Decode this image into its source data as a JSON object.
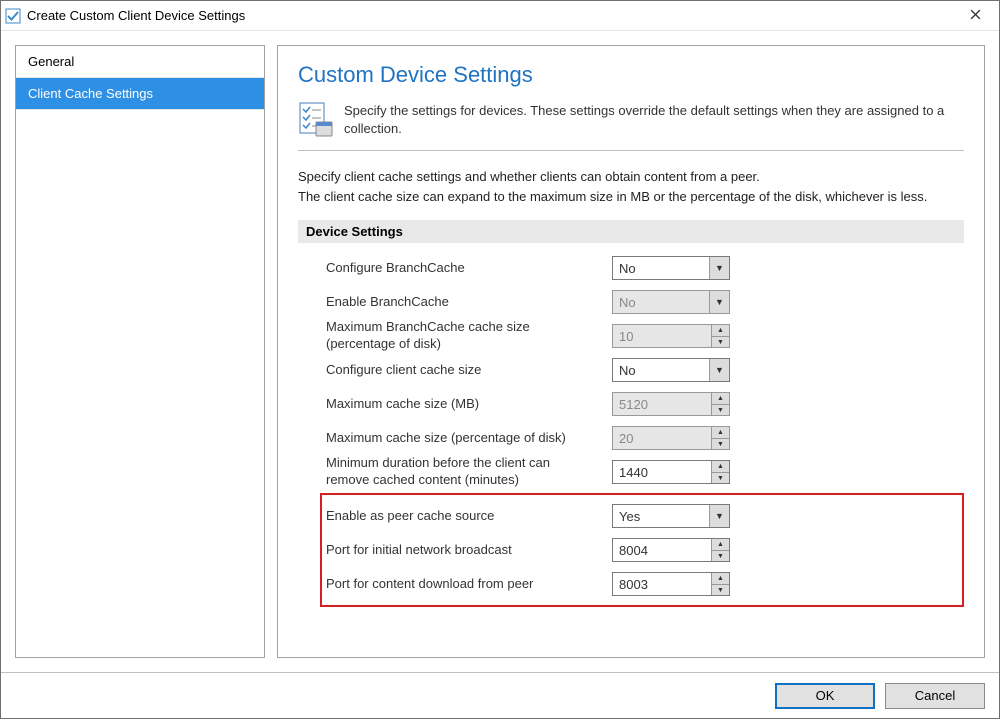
{
  "window": {
    "title": "Create Custom Client Device Settings"
  },
  "sidebar": {
    "items": [
      {
        "label": "General",
        "selected": false
      },
      {
        "label": "Client Cache Settings",
        "selected": true
      }
    ]
  },
  "page": {
    "heading": "Custom Device Settings",
    "intro": "Specify the settings for devices. These settings override the default settings when they are assigned to a collection.",
    "desc_line1": "Specify client cache settings and whether clients can obtain content from a peer.",
    "desc_line2": "The client cache size can expand to the maximum size in MB or the percentage of the disk, whichever is less.",
    "group_header": "Device Settings"
  },
  "settings": [
    {
      "label": "Configure BranchCache",
      "type": "combo",
      "value": "No",
      "enabled": true
    },
    {
      "label": "Enable BranchCache",
      "type": "combo",
      "value": "No",
      "enabled": false
    },
    {
      "label": "Maximum BranchCache cache size (percentage of disk)",
      "type": "spinner",
      "value": "10",
      "enabled": false
    },
    {
      "label": "Configure client cache size",
      "type": "combo",
      "value": "No",
      "enabled": true
    },
    {
      "label": "Maximum cache size (MB)",
      "type": "spinner",
      "value": "5120",
      "enabled": false
    },
    {
      "label": "Maximum cache size (percentage of disk)",
      "type": "spinner",
      "value": "20",
      "enabled": false
    },
    {
      "label": "Minimum duration before the client can remove cached content (minutes)",
      "type": "spinner",
      "value": "1440",
      "enabled": true
    },
    {
      "label": "Enable as peer cache source",
      "type": "combo",
      "value": "Yes",
      "enabled": true
    },
    {
      "label": "Port for initial network broadcast",
      "type": "spinner",
      "value": "8004",
      "enabled": true
    },
    {
      "label": "Port for content download from peer",
      "type": "spinner",
      "value": "8003",
      "enabled": true
    }
  ],
  "footer": {
    "ok": "OK",
    "cancel": "Cancel"
  }
}
